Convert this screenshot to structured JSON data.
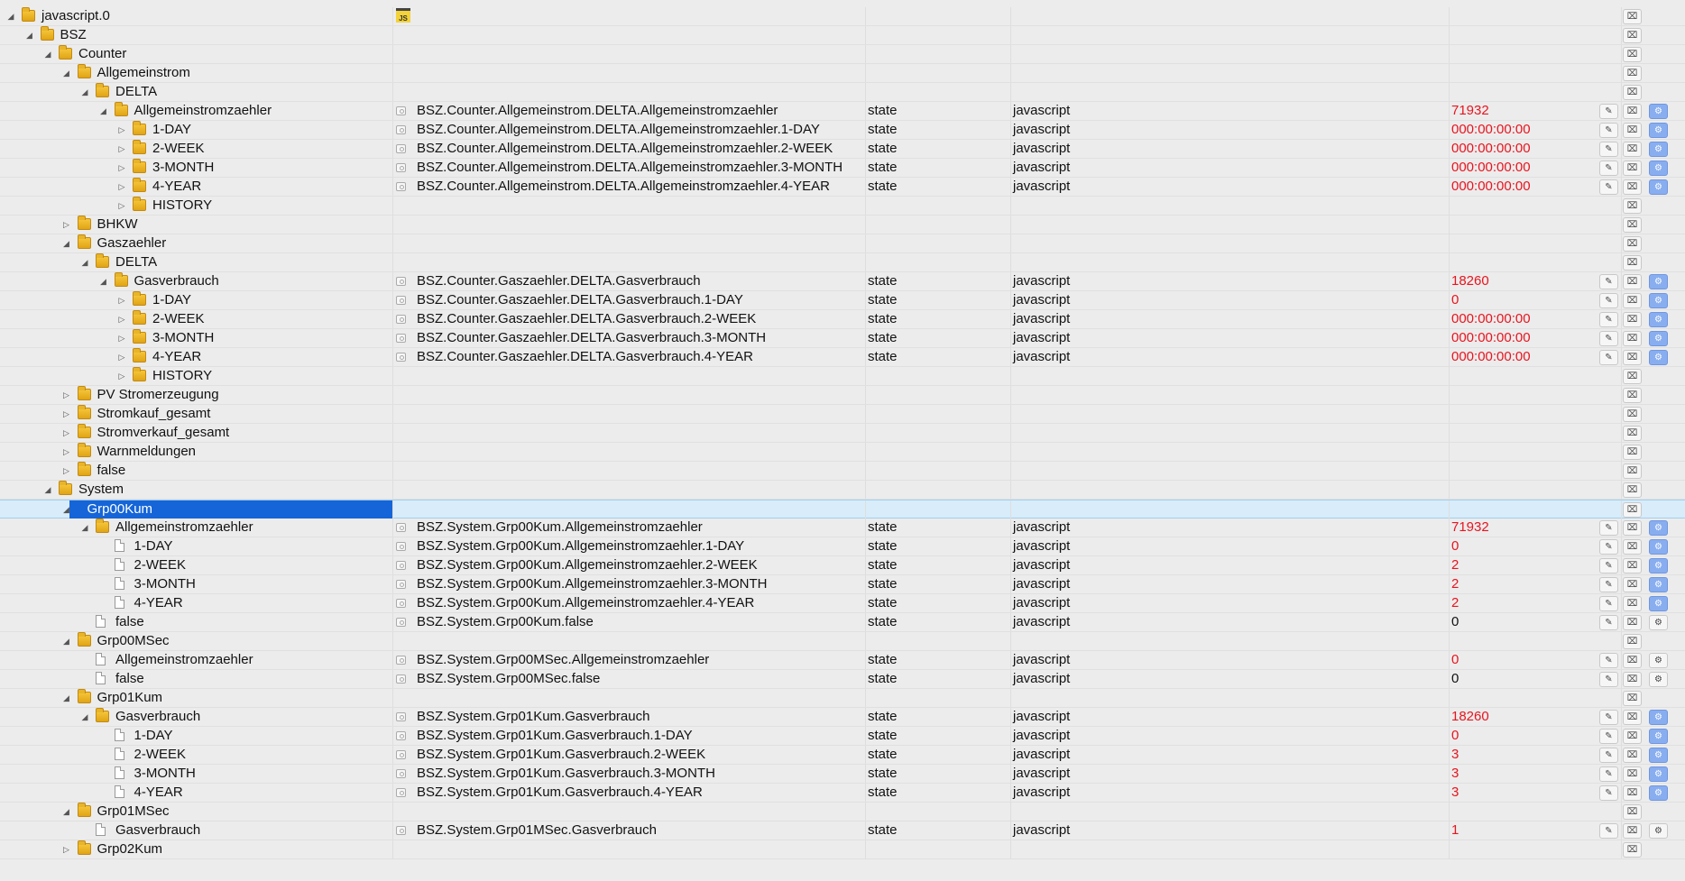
{
  "colors": {
    "selected": "#1565d8",
    "value_red": "#e8141e",
    "folder": "#f0b72a",
    "config_blue": "#89aef0"
  },
  "icons": {
    "folder": "folder-icon",
    "file": "state-file-icon",
    "object": "state-object-icon",
    "script": "javascript-icon",
    "edit": "edit-icon",
    "delete": "trash-icon",
    "config": "gear-icon"
  },
  "rows": [
    {
      "n": "javascript.0",
      "d": 0,
      "k": "f",
      "t": "o",
      "js": true,
      "red": false
    },
    {
      "n": "BSZ",
      "d": 1,
      "k": "f",
      "t": "o"
    },
    {
      "n": "Counter",
      "d": 2,
      "k": "f",
      "t": "o"
    },
    {
      "n": "Allgemeinstrom",
      "d": 3,
      "k": "f",
      "t": "o"
    },
    {
      "n": "DELTA",
      "d": 4,
      "k": "f",
      "t": "o"
    },
    {
      "n": "Allgemeinstromzaehler",
      "d": 5,
      "k": "f",
      "t": "o",
      "id": "BSZ.Counter.Allgemeinstrom.DELTA.Allgemeinstromzaehler",
      "type": "state",
      "role": "javascript",
      "val": "71932",
      "red": true,
      "cfg": "b"
    },
    {
      "n": "1-DAY",
      "d": 6,
      "k": "f",
      "t": "c",
      "id": "BSZ.Counter.Allgemeinstrom.DELTA.Allgemeinstromzaehler.1-DAY",
      "type": "state",
      "role": "javascript",
      "val": "000:00:00:00",
      "red": true,
      "cfg": "b"
    },
    {
      "n": "2-WEEK",
      "d": 6,
      "k": "f",
      "t": "c",
      "id": "BSZ.Counter.Allgemeinstrom.DELTA.Allgemeinstromzaehler.2-WEEK",
      "type": "state",
      "role": "javascript",
      "val": "000:00:00:00",
      "red": true,
      "cfg": "b"
    },
    {
      "n": "3-MONTH",
      "d": 6,
      "k": "f",
      "t": "c",
      "id": "BSZ.Counter.Allgemeinstrom.DELTA.Allgemeinstromzaehler.3-MONTH",
      "type": "state",
      "role": "javascript",
      "val": "000:00:00:00",
      "red": true,
      "cfg": "b"
    },
    {
      "n": "4-YEAR",
      "d": 6,
      "k": "f",
      "t": "c",
      "id": "BSZ.Counter.Allgemeinstrom.DELTA.Allgemeinstromzaehler.4-YEAR",
      "type": "state",
      "role": "javascript",
      "val": "000:00:00:00",
      "red": true,
      "cfg": "b"
    },
    {
      "n": "HISTORY",
      "d": 6,
      "k": "f",
      "t": "c"
    },
    {
      "n": "BHKW",
      "d": 3,
      "k": "f",
      "t": "c"
    },
    {
      "n": "Gaszaehler",
      "d": 3,
      "k": "f",
      "t": "o"
    },
    {
      "n": "DELTA",
      "d": 4,
      "k": "f",
      "t": "o"
    },
    {
      "n": "Gasverbrauch",
      "d": 5,
      "k": "f",
      "t": "o",
      "id": "BSZ.Counter.Gaszaehler.DELTA.Gasverbrauch",
      "type": "state",
      "role": "javascript",
      "val": "18260",
      "red": true,
      "cfg": "b"
    },
    {
      "n": "1-DAY",
      "d": 6,
      "k": "f",
      "t": "c",
      "id": "BSZ.Counter.Gaszaehler.DELTA.Gasverbrauch.1-DAY",
      "type": "state",
      "role": "javascript",
      "val": "0",
      "red": true,
      "cfg": "b"
    },
    {
      "n": "2-WEEK",
      "d": 6,
      "k": "f",
      "t": "c",
      "id": "BSZ.Counter.Gaszaehler.DELTA.Gasverbrauch.2-WEEK",
      "type": "state",
      "role": "javascript",
      "val": "000:00:00:00",
      "red": true,
      "cfg": "b"
    },
    {
      "n": "3-MONTH",
      "d": 6,
      "k": "f",
      "t": "c",
      "id": "BSZ.Counter.Gaszaehler.DELTA.Gasverbrauch.3-MONTH",
      "type": "state",
      "role": "javascript",
      "val": "000:00:00:00",
      "red": true,
      "cfg": "b"
    },
    {
      "n": "4-YEAR",
      "d": 6,
      "k": "f",
      "t": "c",
      "id": "BSZ.Counter.Gaszaehler.DELTA.Gasverbrauch.4-YEAR",
      "type": "state",
      "role": "javascript",
      "val": "000:00:00:00",
      "red": true,
      "cfg": "b"
    },
    {
      "n": "HISTORY",
      "d": 6,
      "k": "f",
      "t": "c"
    },
    {
      "n": "PV Stromerzeugung",
      "d": 3,
      "k": "f",
      "t": "c"
    },
    {
      "n": "Stromkauf_gesamt",
      "d": 3,
      "k": "f",
      "t": "c"
    },
    {
      "n": "Stromverkauf_gesamt",
      "d": 3,
      "k": "f",
      "t": "c"
    },
    {
      "n": "Warnmeldungen",
      "d": 3,
      "k": "f",
      "t": "c"
    },
    {
      "n": "false",
      "d": 3,
      "k": "f",
      "t": "c"
    },
    {
      "n": "System",
      "d": 2,
      "k": "f",
      "t": "o"
    },
    {
      "n": "Grp00Kum",
      "d": 3,
      "k": "f",
      "t": "o",
      "sel": true
    },
    {
      "n": "Allgemeinstromzaehler",
      "d": 4,
      "k": "f",
      "t": "o",
      "id": "BSZ.System.Grp00Kum.Allgemeinstromzaehler",
      "type": "state",
      "role": "javascript",
      "val": "71932",
      "red": true,
      "cfg": "b"
    },
    {
      "n": "1-DAY",
      "d": 5,
      "k": "d",
      "t": "",
      "id": "BSZ.System.Grp00Kum.Allgemeinstromzaehler.1-DAY",
      "type": "state",
      "role": "javascript",
      "val": "0",
      "red": true,
      "cfg": "b"
    },
    {
      "n": "2-WEEK",
      "d": 5,
      "k": "d",
      "t": "",
      "id": "BSZ.System.Grp00Kum.Allgemeinstromzaehler.2-WEEK",
      "type": "state",
      "role": "javascript",
      "val": "2",
      "red": true,
      "cfg": "b"
    },
    {
      "n": "3-MONTH",
      "d": 5,
      "k": "d",
      "t": "",
      "id": "BSZ.System.Grp00Kum.Allgemeinstromzaehler.3-MONTH",
      "type": "state",
      "role": "javascript",
      "val": "2",
      "red": true,
      "cfg": "b"
    },
    {
      "n": "4-YEAR",
      "d": 5,
      "k": "d",
      "t": "",
      "id": "BSZ.System.Grp00Kum.Allgemeinstromzaehler.4-YEAR",
      "type": "state",
      "role": "javascript",
      "val": "2",
      "red": true,
      "cfg": "b"
    },
    {
      "n": "false",
      "d": 4,
      "k": "d",
      "t": "",
      "id": "BSZ.System.Grp00Kum.false",
      "type": "state",
      "role": "javascript",
      "val": "0",
      "red": false,
      "cfg": "g"
    },
    {
      "n": "Grp00MSec",
      "d": 3,
      "k": "f",
      "t": "o"
    },
    {
      "n": "Allgemeinstromzaehler",
      "d": 4,
      "k": "d",
      "t": "",
      "id": "BSZ.System.Grp00MSec.Allgemeinstromzaehler",
      "type": "state",
      "role": "javascript",
      "val": "0",
      "red": true,
      "cfg": "g"
    },
    {
      "n": "false",
      "d": 4,
      "k": "d",
      "t": "",
      "id": "BSZ.System.Grp00MSec.false",
      "type": "state",
      "role": "javascript",
      "val": "0",
      "red": false,
      "cfg": "g"
    },
    {
      "n": "Grp01Kum",
      "d": 3,
      "k": "f",
      "t": "o"
    },
    {
      "n": "Gasverbrauch",
      "d": 4,
      "k": "f",
      "t": "o",
      "id": "BSZ.System.Grp01Kum.Gasverbrauch",
      "type": "state",
      "role": "javascript",
      "val": "18260",
      "red": true,
      "cfg": "b"
    },
    {
      "n": "1-DAY",
      "d": 5,
      "k": "d",
      "t": "",
      "id": "BSZ.System.Grp01Kum.Gasverbrauch.1-DAY",
      "type": "state",
      "role": "javascript",
      "val": "0",
      "red": true,
      "cfg": "b"
    },
    {
      "n": "2-WEEK",
      "d": 5,
      "k": "d",
      "t": "",
      "id": "BSZ.System.Grp01Kum.Gasverbrauch.2-WEEK",
      "type": "state",
      "role": "javascript",
      "val": "3",
      "red": true,
      "cfg": "b"
    },
    {
      "n": "3-MONTH",
      "d": 5,
      "k": "d",
      "t": "",
      "id": "BSZ.System.Grp01Kum.Gasverbrauch.3-MONTH",
      "type": "state",
      "role": "javascript",
      "val": "3",
      "red": true,
      "cfg": "b"
    },
    {
      "n": "4-YEAR",
      "d": 5,
      "k": "d",
      "t": "",
      "id": "BSZ.System.Grp01Kum.Gasverbrauch.4-YEAR",
      "type": "state",
      "role": "javascript",
      "val": "3",
      "red": true,
      "cfg": "b"
    },
    {
      "n": "Grp01MSec",
      "d": 3,
      "k": "f",
      "t": "o"
    },
    {
      "n": "Gasverbrauch",
      "d": 4,
      "k": "d",
      "t": "",
      "id": "BSZ.System.Grp01MSec.Gasverbrauch",
      "type": "state",
      "role": "javascript",
      "val": "1",
      "red": true,
      "cfg": "g"
    },
    {
      "n": "Grp02Kum",
      "d": 3,
      "k": "f",
      "t": "c"
    }
  ]
}
